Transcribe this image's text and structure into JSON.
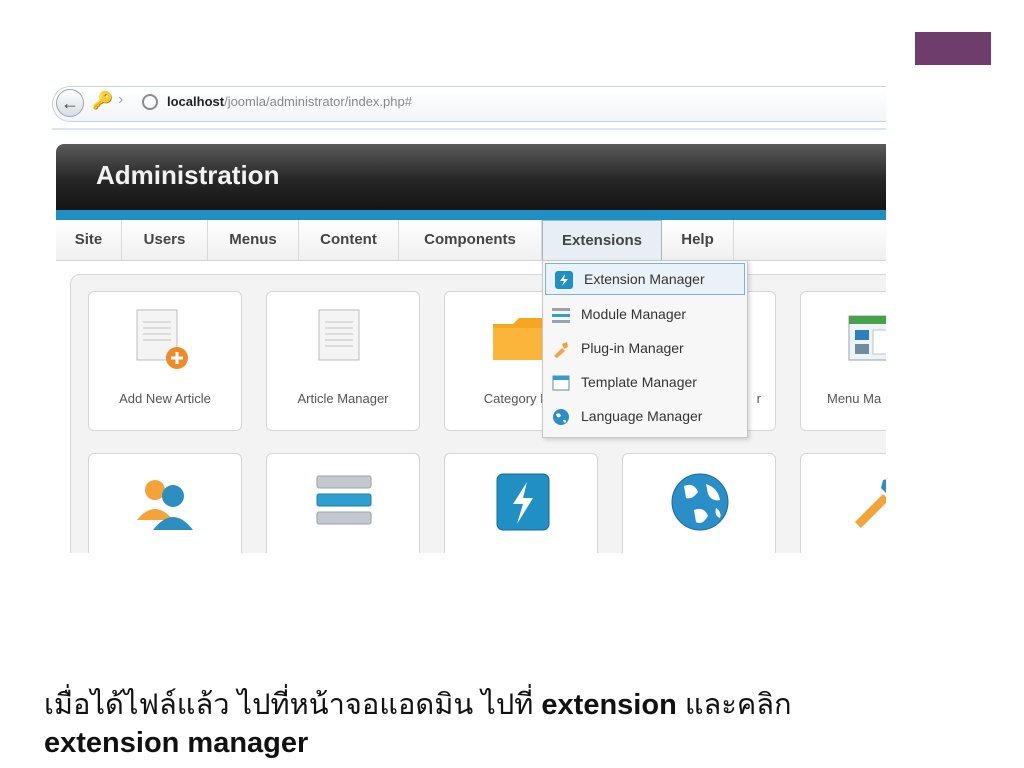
{
  "accent_color": "#6e3d6c",
  "browser": {
    "url_host": "localhost",
    "url_path": "/joomla/administrator/index.php#"
  },
  "header": {
    "title": "Administration"
  },
  "menu": {
    "items": [
      {
        "label": "Site"
      },
      {
        "label": "Users"
      },
      {
        "label": "Menus"
      },
      {
        "label": "Content"
      },
      {
        "label": "Components"
      },
      {
        "label": "Extensions"
      },
      {
        "label": "Help"
      }
    ],
    "active": "Extensions"
  },
  "dropdown": {
    "items": [
      {
        "label": "Extension Manager",
        "icon": "extension-manager-icon",
        "selected": true
      },
      {
        "label": "Module Manager",
        "icon": "module-manager-icon"
      },
      {
        "label": "Plug-in Manager",
        "icon": "plugin-icon"
      },
      {
        "label": "Template Manager",
        "icon": "template-icon"
      },
      {
        "label": "Language Manager",
        "icon": "language-globe-icon"
      }
    ]
  },
  "tiles": {
    "row1": [
      {
        "label": "Add New Article",
        "icon": "add-article-icon"
      },
      {
        "label": "Article Manager",
        "icon": "article-manager-icon"
      },
      {
        "label": "Category Ma",
        "icon": "folder-icon"
      },
      {
        "label": "r",
        "icon": ""
      },
      {
        "label": "Menu Ma",
        "icon": "menu-manager-icon"
      }
    ],
    "row2": [
      {
        "icon": "users-icon"
      },
      {
        "icon": "module-stack-icon"
      },
      {
        "icon": "extension-bolt-icon"
      },
      {
        "icon": "world-globe-icon"
      },
      {
        "icon": "tools-icon"
      }
    ]
  },
  "caption": {
    "part1": "เมื่อได้ไฟล์แล้ว ไปที่หน้าจอแอดมิน ไปที่ ",
    "part2": "extension",
    "part3": " และคลิก",
    "part4": "extension manager"
  }
}
